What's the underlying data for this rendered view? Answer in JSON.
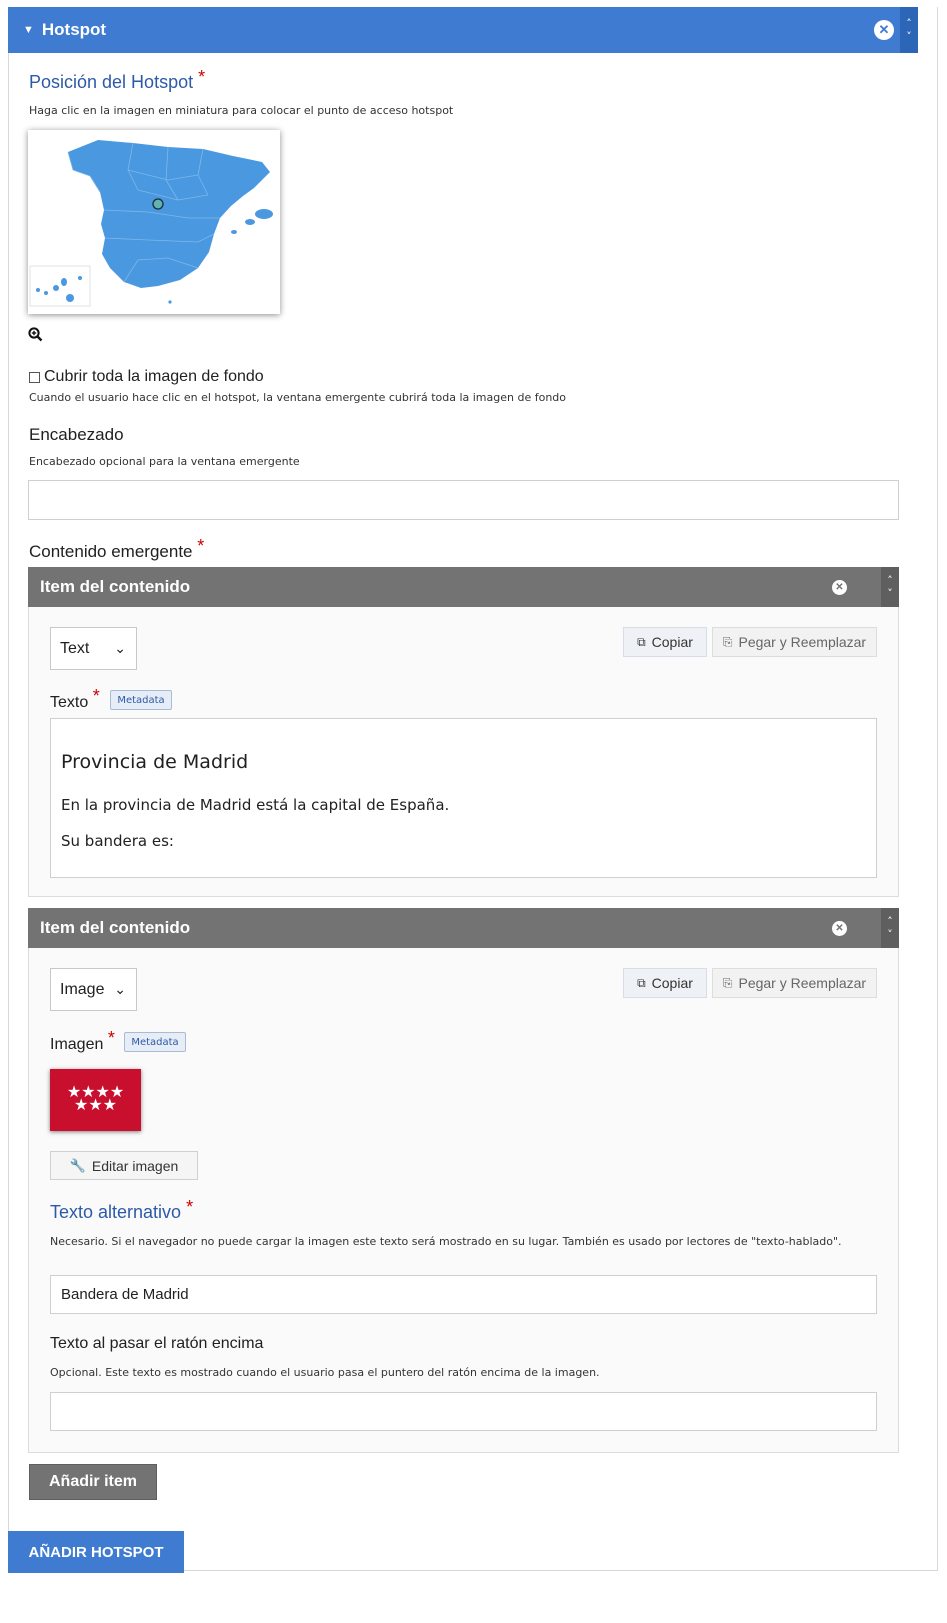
{
  "hotspot": {
    "header_title": "Hotspot",
    "remove_symbol": "✕",
    "position": {
      "label": "Posición del Hotspot",
      "required": "*",
      "description": "Haga clic en la imagen en miniatura para colocar el punto de acceso hotspot"
    },
    "cover": {
      "label": "Cubrir toda la imagen de fondo",
      "description": "Cuando el usuario hace clic en el hotspot, la ventana emergente cubrirá toda la imagen de fondo",
      "checked": false
    },
    "heading": {
      "label": "Encabezado",
      "description": "Encabezado opcional para la ventana emergente",
      "value": ""
    },
    "popup": {
      "label": "Contenido emergente",
      "required": "*",
      "items": [
        {
          "header": "Item del contenido",
          "type": "Text",
          "copy_label": "Copiar",
          "paste_label": "Pegar y Reemplazar",
          "field_label": "Texto",
          "required": "*",
          "metadata": "Metadata",
          "editor": {
            "heading": "Provincia de Madrid",
            "paragraphs": [
              "En la provincia de Madrid está la capital de España.",
              "Su bandera es:"
            ]
          }
        },
        {
          "header": "Item del contenido",
          "type": "Image",
          "copy_label": "Copiar",
          "paste_label": "Pegar y Reemplazar",
          "field_label": "Imagen",
          "required": "*",
          "metadata": "Metadata",
          "flag_stars": "★★★★",
          "flag_stars2": "★★★",
          "edit_image_label": "Editar imagen",
          "alt": {
            "label": "Texto alternativo",
            "required": "*",
            "description": "Necesario. Si el navegador no puede cargar la imagen este texto será mostrado en su lugar. También es usado por lectores de \"texto-hablado\".",
            "value": "Bandera de Madrid"
          },
          "hover": {
            "label": "Texto al pasar el ratón encima",
            "description": "Opcional. Este texto es mostrado cuando el usuario pasa el puntero del ratón encima de la imagen.",
            "value": ""
          }
        }
      ],
      "add_item_label": "Añadir item"
    }
  },
  "add_hotspot_label": "AÑADIR HOTSPOT",
  "colors": {
    "accent": "#3e7bd1",
    "item_header": "#737373",
    "map_fill": "#4a98e0",
    "flag_red": "#c8102e"
  },
  "icons": [
    "caret-down-icon",
    "close-circle-icon",
    "sort-arrows-icon",
    "zoom-in-icon",
    "copy-icon",
    "paste-icon",
    "wrench-icon",
    "chevron-down-icon"
  ]
}
